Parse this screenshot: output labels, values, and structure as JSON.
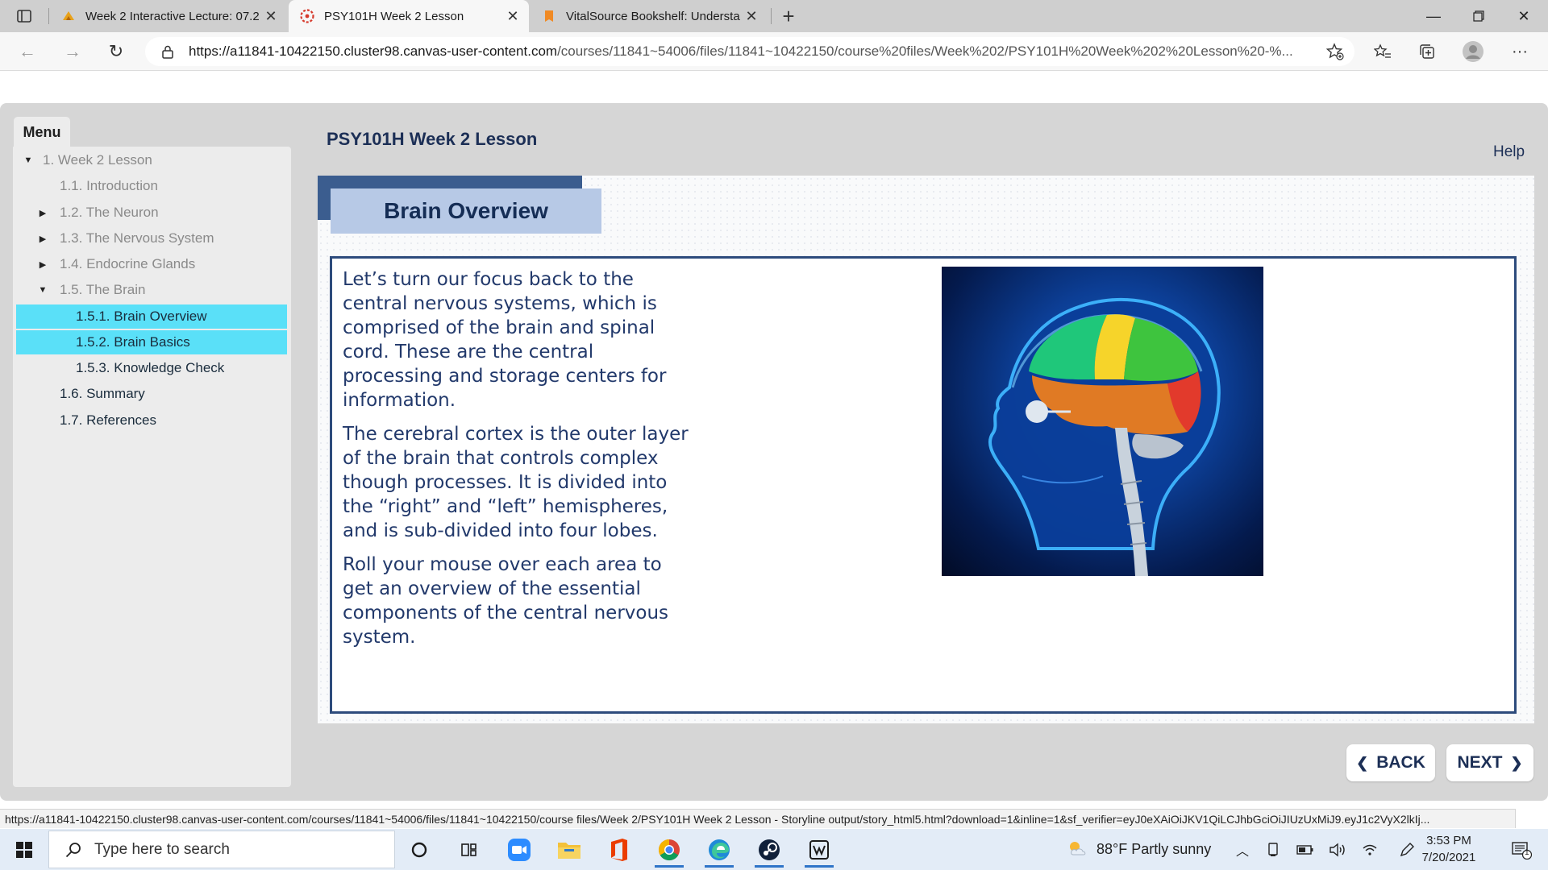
{
  "browser": {
    "tabs": [
      {
        "title": "Week 2 Interactive Lecture: 07.2",
        "active": false
      },
      {
        "title": "PSY101H Week 2 Lesson",
        "active": true
      },
      {
        "title": "VitalSource Bookshelf: Understar",
        "active": false
      }
    ],
    "url_host": "https://a11841-10422150.cluster98.canvas-user-content.com",
    "url_path": "/courses/11841~54006/files/11841~10422150/course%20files/Week%202/PSY101H%20Week%202%20Lesson%20-%...",
    "window_controls": [
      "minimize",
      "restore",
      "close"
    ]
  },
  "lesson": {
    "title": "PSY101H Week 2 Lesson",
    "help": "Help"
  },
  "menu": {
    "heading": "Menu",
    "items": [
      {
        "label": "1. Week 2 Lesson",
        "level": 0,
        "arrow": "down",
        "state": "normal"
      },
      {
        "label": "1.1. Introduction",
        "level": 1,
        "arrow": "",
        "state": "normal"
      },
      {
        "label": "1.2. The Neuron",
        "level": 1,
        "arrow": "right",
        "state": "normal"
      },
      {
        "label": "1.3. The Nervous System",
        "level": 1,
        "arrow": "right",
        "state": "normal"
      },
      {
        "label": "1.4. Endocrine Glands",
        "level": 1,
        "arrow": "right",
        "state": "normal"
      },
      {
        "label": "1.5. The Brain",
        "level": 1,
        "arrow": "down",
        "state": "normal"
      },
      {
        "label": "1.5.1. Brain Overview",
        "level": 2,
        "arrow": "",
        "state": "active"
      },
      {
        "label": "1.5.2. Brain Basics",
        "level": 2,
        "arrow": "",
        "state": "active"
      },
      {
        "label": "1.5.3. Knowledge Check",
        "level": 2,
        "arrow": "",
        "state": "current"
      },
      {
        "label": "1.6. Summary",
        "level": 1,
        "arrow": "",
        "state": "current"
      },
      {
        "label": "1.7. References",
        "level": 1,
        "arrow": "",
        "state": "current"
      }
    ]
  },
  "slide": {
    "heading": "Brain Overview",
    "paragraphs": [
      "Let’s turn our focus back to the central nervous systems, which is comprised of the brain and spinal cord. These are the central processing and storage centers for information.",
      "The cerebral cortex  is the outer layer of the brain that controls complex though processes. It is divided into the “right” and “left” hemispheres, and is sub-divided into four lobes.",
      "Roll your mouse over each area to get an overview of the essential components of the central nervous system."
    ],
    "back_label": "BACK",
    "next_label": "NEXT"
  },
  "status_url": "https://a11841-10422150.cluster98.canvas-user-content.com/courses/11841~54006/files/11841~10422150/course files/Week 2/PSY101H Week 2 Lesson - Storyline output/story_html5.html?download=1&inline=1&sf_verifier=eyJ0eXAiOiJKV1QiLCJhbGciOiJIUzUxMiJ9.eyJ1c2VyX2lkIj...",
  "taskbar": {
    "search_placeholder": "Type here to search",
    "apps": [
      "cortana",
      "task-view",
      "zoom",
      "file-explorer",
      "office",
      "chrome",
      "edge",
      "steam",
      "game"
    ],
    "weather": "88°F  Partly sunny",
    "time": "3:53 PM",
    "date": "7/20/2021",
    "notification_count": "1"
  },
  "colors": {
    "accent_blue": "#1c2f56",
    "menu_highlight": "#5ae0f8",
    "heading_tab": "#b7c9e6",
    "frame_border": "#2d4b7c"
  }
}
